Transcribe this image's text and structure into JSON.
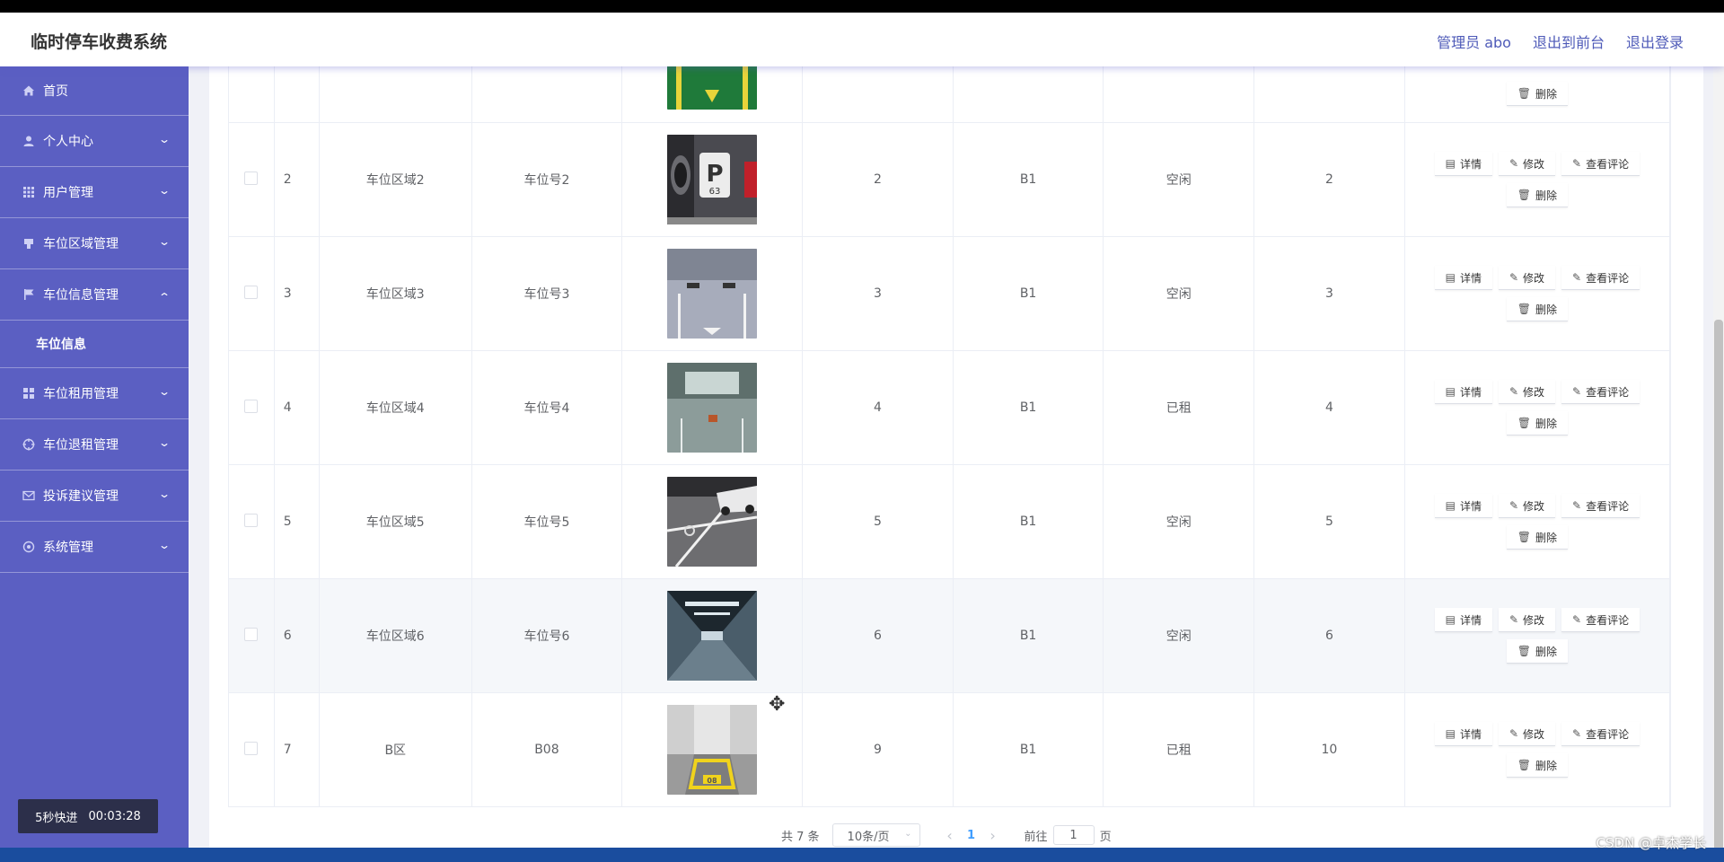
{
  "app": {
    "title": "临时停车收费系统"
  },
  "topbar": {
    "admin": "管理员 abo",
    "to_front": "退出到前台",
    "logout": "退出登录"
  },
  "sidebar": {
    "items": [
      {
        "label": "首页",
        "icon": "home-icon"
      },
      {
        "label": "个人中心",
        "icon": "user-icon"
      },
      {
        "label": "用户管理",
        "icon": "grid-icon"
      },
      {
        "label": "车位区域管理",
        "icon": "parking-icon"
      },
      {
        "label": "车位信息管理",
        "icon": "flag-icon",
        "expanded": true,
        "sub": [
          "车位信息"
        ]
      },
      {
        "label": "车位租用管理",
        "icon": "apps-icon"
      },
      {
        "label": "车位退租管理",
        "icon": "target-icon"
      },
      {
        "label": "投诉建议管理",
        "icon": "mail-icon"
      },
      {
        "label": "系统管理",
        "icon": "settings-icon"
      }
    ],
    "timer_label": "5秒快进",
    "timer_value": "00:03:28"
  },
  "table": {
    "partial_first_delete": "删除",
    "ops": {
      "detail": "详情",
      "edit": "修改",
      "comments": "查看评论",
      "delete": "删除"
    },
    "rows": [
      {
        "idx": "2",
        "area": "车位区域2",
        "no": "车位号2",
        "photo": "parking-photo-2",
        "c1": "2",
        "floor": "B1",
        "status": "空闲",
        "c2": "2"
      },
      {
        "idx": "3",
        "area": "车位区域3",
        "no": "车位号3",
        "photo": "parking-photo-3",
        "c1": "3",
        "floor": "B1",
        "status": "空闲",
        "c2": "3"
      },
      {
        "idx": "4",
        "area": "车位区域4",
        "no": "车位号4",
        "photo": "parking-photo-4",
        "c1": "4",
        "floor": "B1",
        "status": "已租",
        "c2": "4"
      },
      {
        "idx": "5",
        "area": "车位区域5",
        "no": "车位号5",
        "photo": "parking-photo-5",
        "c1": "5",
        "floor": "B1",
        "status": "空闲",
        "c2": "5"
      },
      {
        "idx": "6",
        "area": "车位区域6",
        "no": "车位号6",
        "photo": "parking-photo-6",
        "c1": "6",
        "floor": "B1",
        "status": "空闲",
        "c2": "6"
      },
      {
        "idx": "7",
        "area": "B区",
        "no": "B08",
        "photo": "parking-photo-7",
        "c1": "9",
        "floor": "B1",
        "status": "已租",
        "c2": "10"
      }
    ]
  },
  "pagination": {
    "total": "共 7 条",
    "page_size": "10条/页",
    "current": "1",
    "goto": "前往",
    "goto_value": "1",
    "page_unit": "页"
  },
  "watermark": "CSDN @卓杰学长"
}
